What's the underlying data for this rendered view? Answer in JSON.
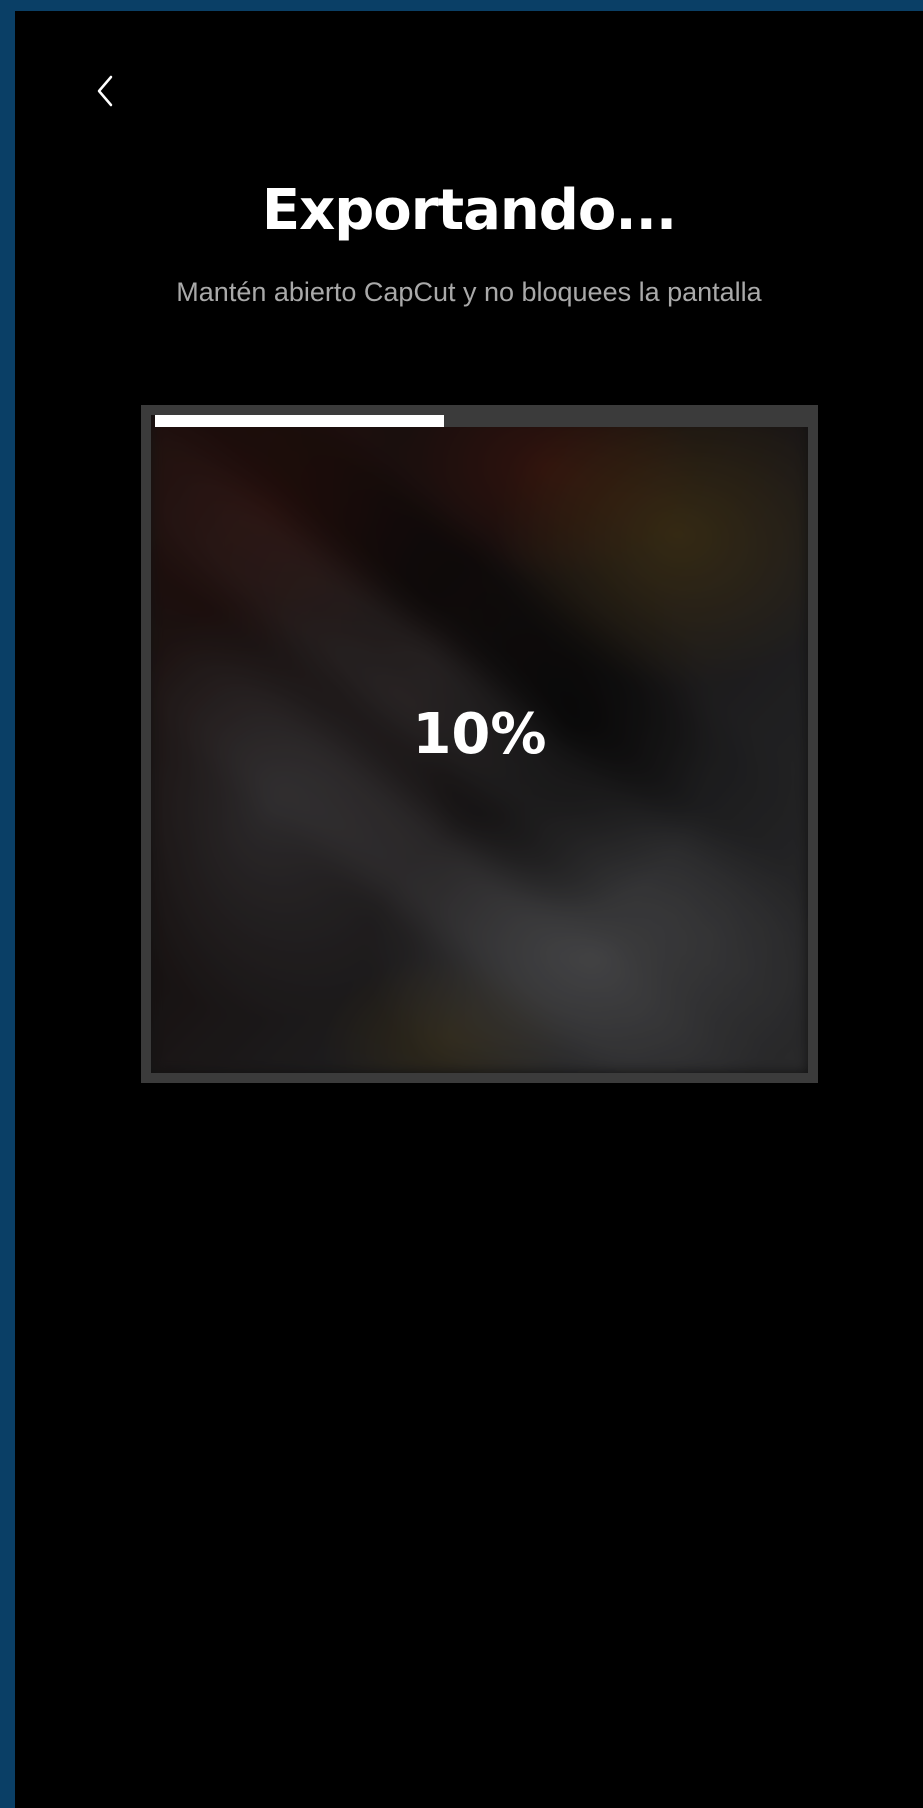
{
  "header": {
    "back_icon": "chevron-left-icon"
  },
  "export": {
    "title": "Exportando...",
    "subtitle": "Mantén abierto CapCut y no bloquees la pantalla",
    "progress_percent": 10,
    "progress_label": "10%",
    "progress_bar_fill_fraction": 0.436
  },
  "colors": {
    "background": "#000000",
    "device_frame": "#0a3f66",
    "text_primary": "#ffffff",
    "text_secondary": "#a9a9a9",
    "progress_fill": "#ffffff",
    "progress_track": "#3b3b3b"
  }
}
